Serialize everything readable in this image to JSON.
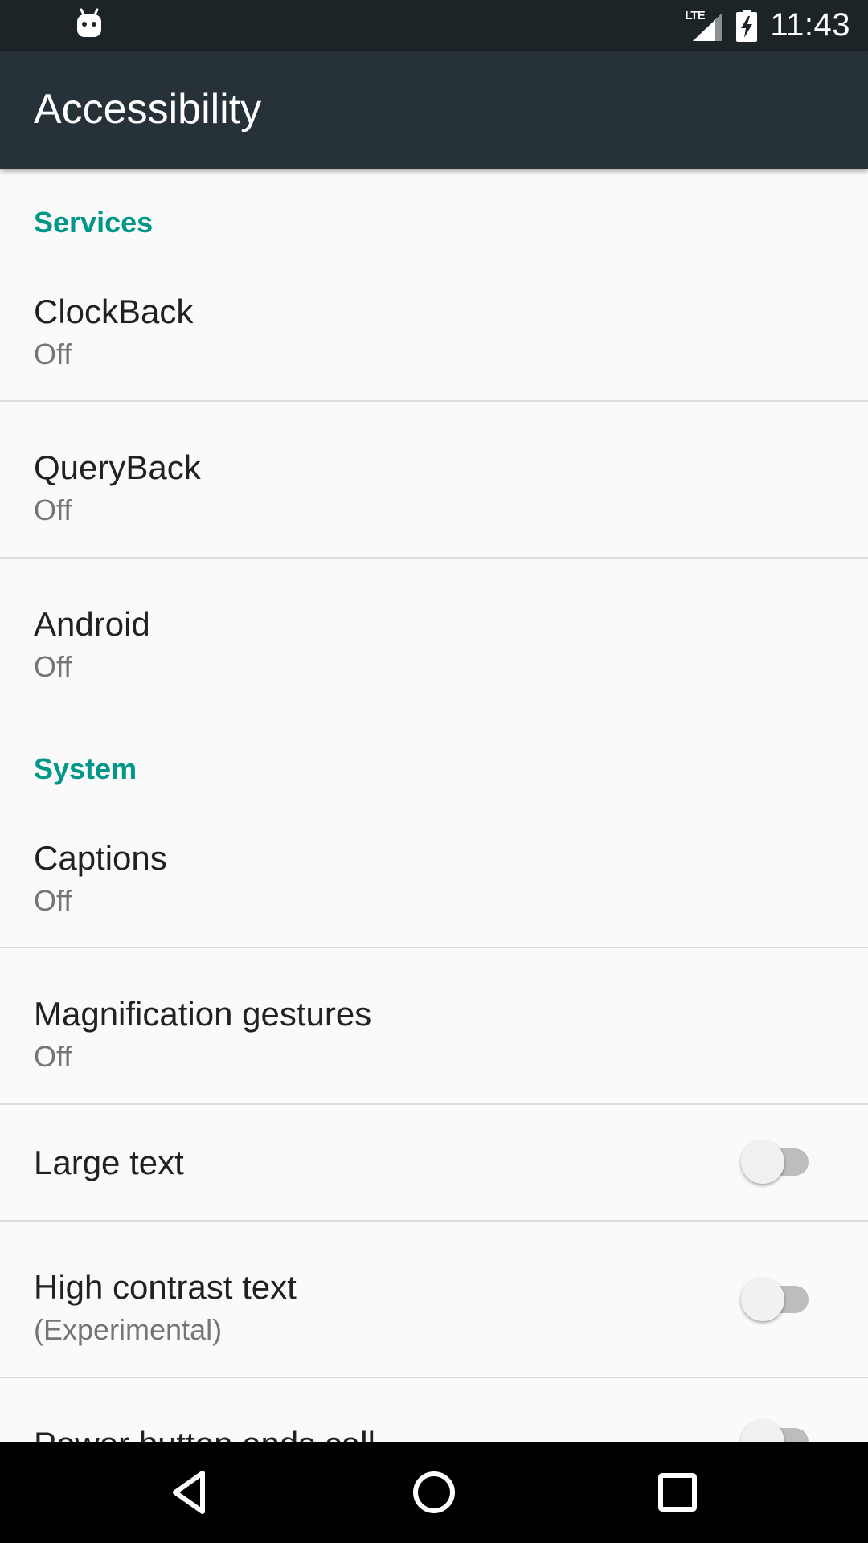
{
  "status_bar": {
    "time": "11:43",
    "network": "LTE",
    "icons": [
      "android-robot-icon",
      "signal-icon",
      "battery-charging-icon"
    ]
  },
  "app_bar": {
    "title": "Accessibility"
  },
  "sections": {
    "services": {
      "header": "Services",
      "items": [
        {
          "title": "ClockBack",
          "summary": "Off"
        },
        {
          "title": "QueryBack",
          "summary": "Off"
        },
        {
          "title": "Android",
          "summary": "Off"
        }
      ]
    },
    "system": {
      "header": "System",
      "items": [
        {
          "title": "Captions",
          "summary": "Off"
        },
        {
          "title": "Magnification gestures",
          "summary": "Off"
        },
        {
          "title": "Large text",
          "switch_on": false
        },
        {
          "title": "High contrast text",
          "summary": "(Experimental)",
          "switch_on": false
        },
        {
          "title": "Power button ends call",
          "switch_on": false
        }
      ]
    }
  },
  "nav_bar": {
    "icons": [
      "back-icon",
      "home-icon",
      "recents-icon"
    ]
  },
  "colors": {
    "status_bar": "#1c2428",
    "app_bar": "#263238",
    "accent": "#009688",
    "background": "#fafafa"
  }
}
